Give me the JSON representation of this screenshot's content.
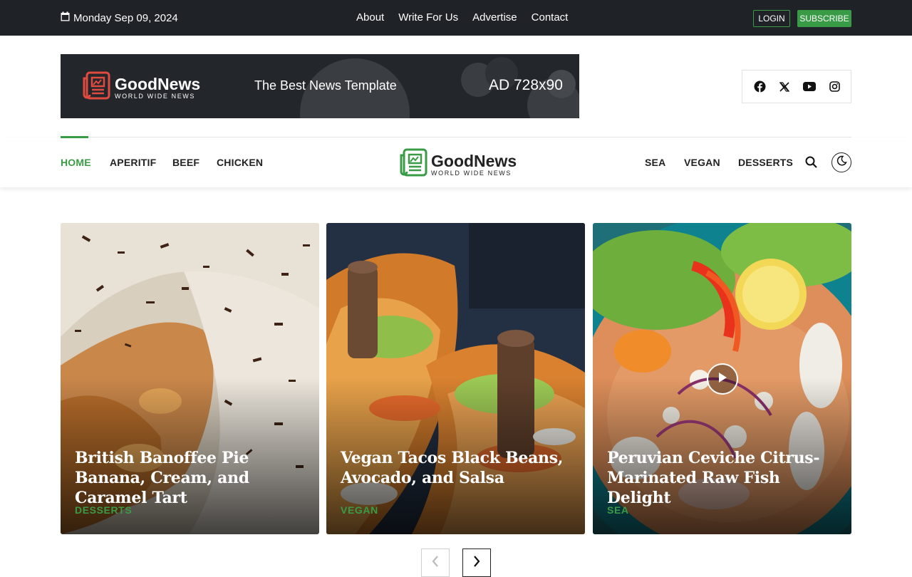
{
  "topbar": {
    "date": "Monday Sep 09, 2024",
    "links": [
      "About",
      "Write For Us",
      "Advertise",
      "Contact"
    ],
    "login_label": "LOGIN",
    "subscribe_label": "SUBSCRIBE"
  },
  "ad": {
    "brand": "GoodNews",
    "brand_sub": "WORLD WIDE NEWS",
    "tagline": "The Best News Template",
    "size": "AD 728x90"
  },
  "social": [
    "facebook-icon",
    "x-icon",
    "youtube-icon",
    "instagram-icon"
  ],
  "nav": {
    "left": [
      "HOME",
      "APERITIF",
      "BEEF",
      "CHICKEN"
    ],
    "right": [
      "SEA",
      "VEGAN",
      "DESSERTS"
    ],
    "logo_brand": "GoodNews",
    "logo_sub": "WORLD WIDE NEWS",
    "active": "HOME"
  },
  "cards": [
    {
      "title": "British Banoffee Pie Banana, Cream, and Caramel Tart",
      "category": "DESSERTS"
    },
    {
      "title": "Vegan Tacos Black Beans, Avocado, and Salsa",
      "category": "VEGAN"
    },
    {
      "title": "Peruvian Ceviche Citrus-Marinated Raw Fish Delight",
      "category": "SEA"
    }
  ],
  "colors": {
    "accent": "#3a9b47",
    "dark": "#1f2226"
  }
}
